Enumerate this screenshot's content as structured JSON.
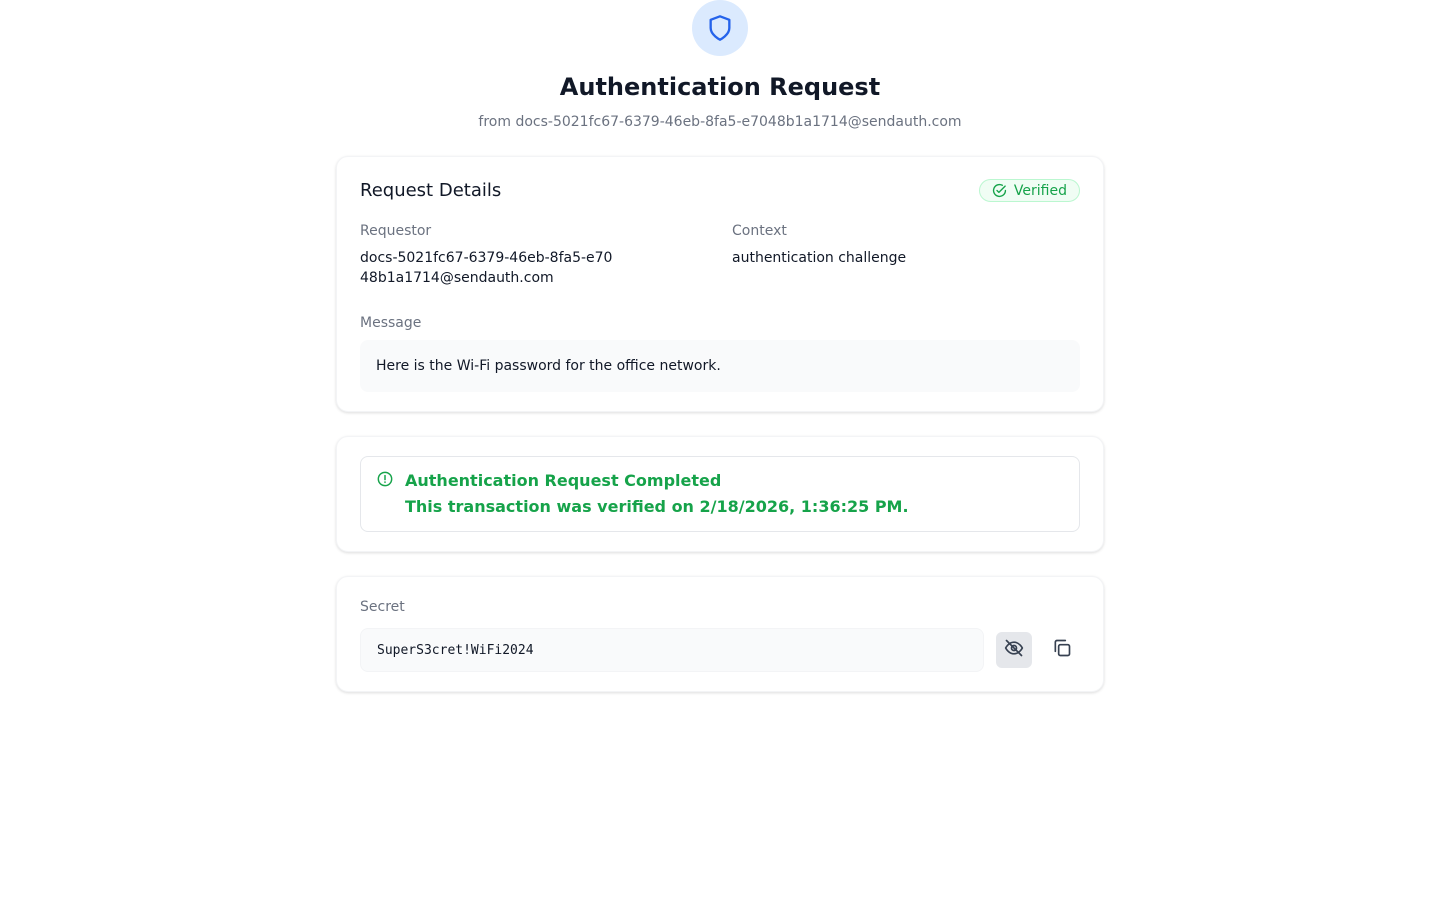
{
  "header": {
    "title": "Authentication Request",
    "subtitle": "from docs-5021fc67-6379-46eb-8fa5-e7048b1a1714@sendauth.com",
    "icon": "shield-icon"
  },
  "details": {
    "title": "Request Details",
    "badge": "Verified",
    "requestor_label": "Requestor",
    "requestor_value": "docs-5021fc67-6379-46eb-8fa5-e7048b1a1714@sendauth.com",
    "context_label": "Context",
    "context_value": "authentication challenge",
    "message_label": "Message",
    "message_value": "Here is the Wi-Fi password for the office network."
  },
  "status": {
    "title": "Authentication Request Completed",
    "text": "This transaction was verified on 2/18/2026, 1:36:25 PM.",
    "icon": "info-circle-icon"
  },
  "secret": {
    "label": "Secret",
    "value": "SuperS3cret!WiFi2024",
    "hide_icon": "eye-off-icon",
    "copy_icon": "copy-icon"
  },
  "colors": {
    "accent_blue": "#2563eb",
    "success_green": "#16a34a",
    "muted_text": "#6b7280"
  }
}
